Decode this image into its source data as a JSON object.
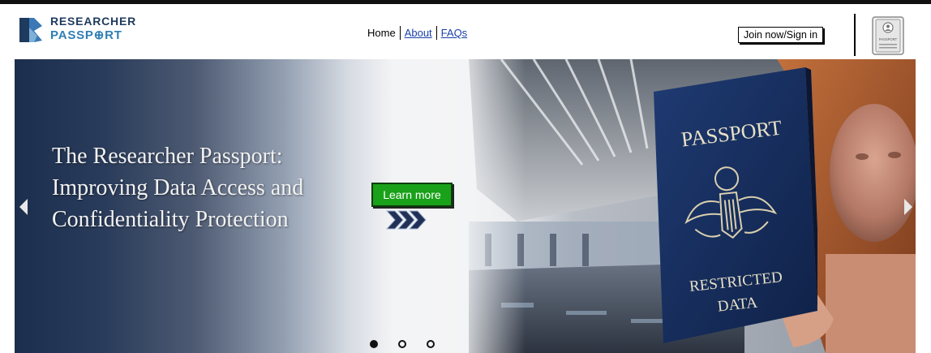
{
  "brand": {
    "name_line1": "RESEARCHER",
    "name_line2": "PASSP⊕RT",
    "colors": {
      "dark": "#1f3a5f",
      "accent": "#2f7fb3"
    }
  },
  "nav": {
    "home": "Home",
    "about": "About",
    "faqs": "FAQs"
  },
  "header": {
    "join_label": "Join now/Sign in",
    "profile_icon": "passport-id-icon",
    "profile_icon_text": "PASSPORT"
  },
  "hero": {
    "title": "The Researcher Passport: Improving Data Access and Confidentiality Protection",
    "cta_label": "Learn more",
    "cta_color": "#1aa11a",
    "passport_cover_title": "PASSPORT",
    "passport_cover_line1": "RESTRICTED",
    "passport_cover_line2": "DATA",
    "slides": {
      "count": 3,
      "active": 1
    }
  }
}
